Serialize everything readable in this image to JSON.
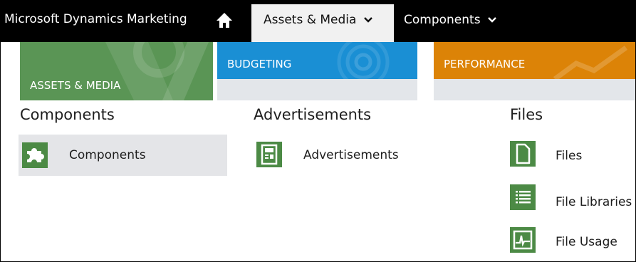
{
  "topnav": {
    "app_title": "Microsoft Dynamics Marketing",
    "active_tab": "Assets & Media",
    "second_tab": "Components"
  },
  "tiles": {
    "assets": "ASSETS & MEDIA",
    "budgeting": "BUDGETING",
    "performance": "PERFORMANCE"
  },
  "sections": {
    "components": {
      "title": "Components",
      "items": [
        {
          "label": "Components",
          "icon": "puzzle-icon"
        }
      ]
    },
    "advertisements": {
      "title": "Advertisements",
      "items": [
        {
          "label": "Advertisements",
          "icon": "advertisement-icon"
        }
      ]
    },
    "files": {
      "title": "Files",
      "items": [
        {
          "label": "Files",
          "icon": "file-icon"
        },
        {
          "label": "File Libraries",
          "icon": "list-icon"
        },
        {
          "label": "File Usage",
          "icon": "chart-icon"
        }
      ]
    }
  },
  "colors": {
    "nav_bg": "#000000",
    "active_tab_bg": "#f1f1f1",
    "assets_green": "#5a9555",
    "budgeting_blue": "#1a8fd4",
    "performance_orange": "#dc8307",
    "icon_green": "#4c8a45",
    "selected_item_bg": "#e4e5e8"
  }
}
